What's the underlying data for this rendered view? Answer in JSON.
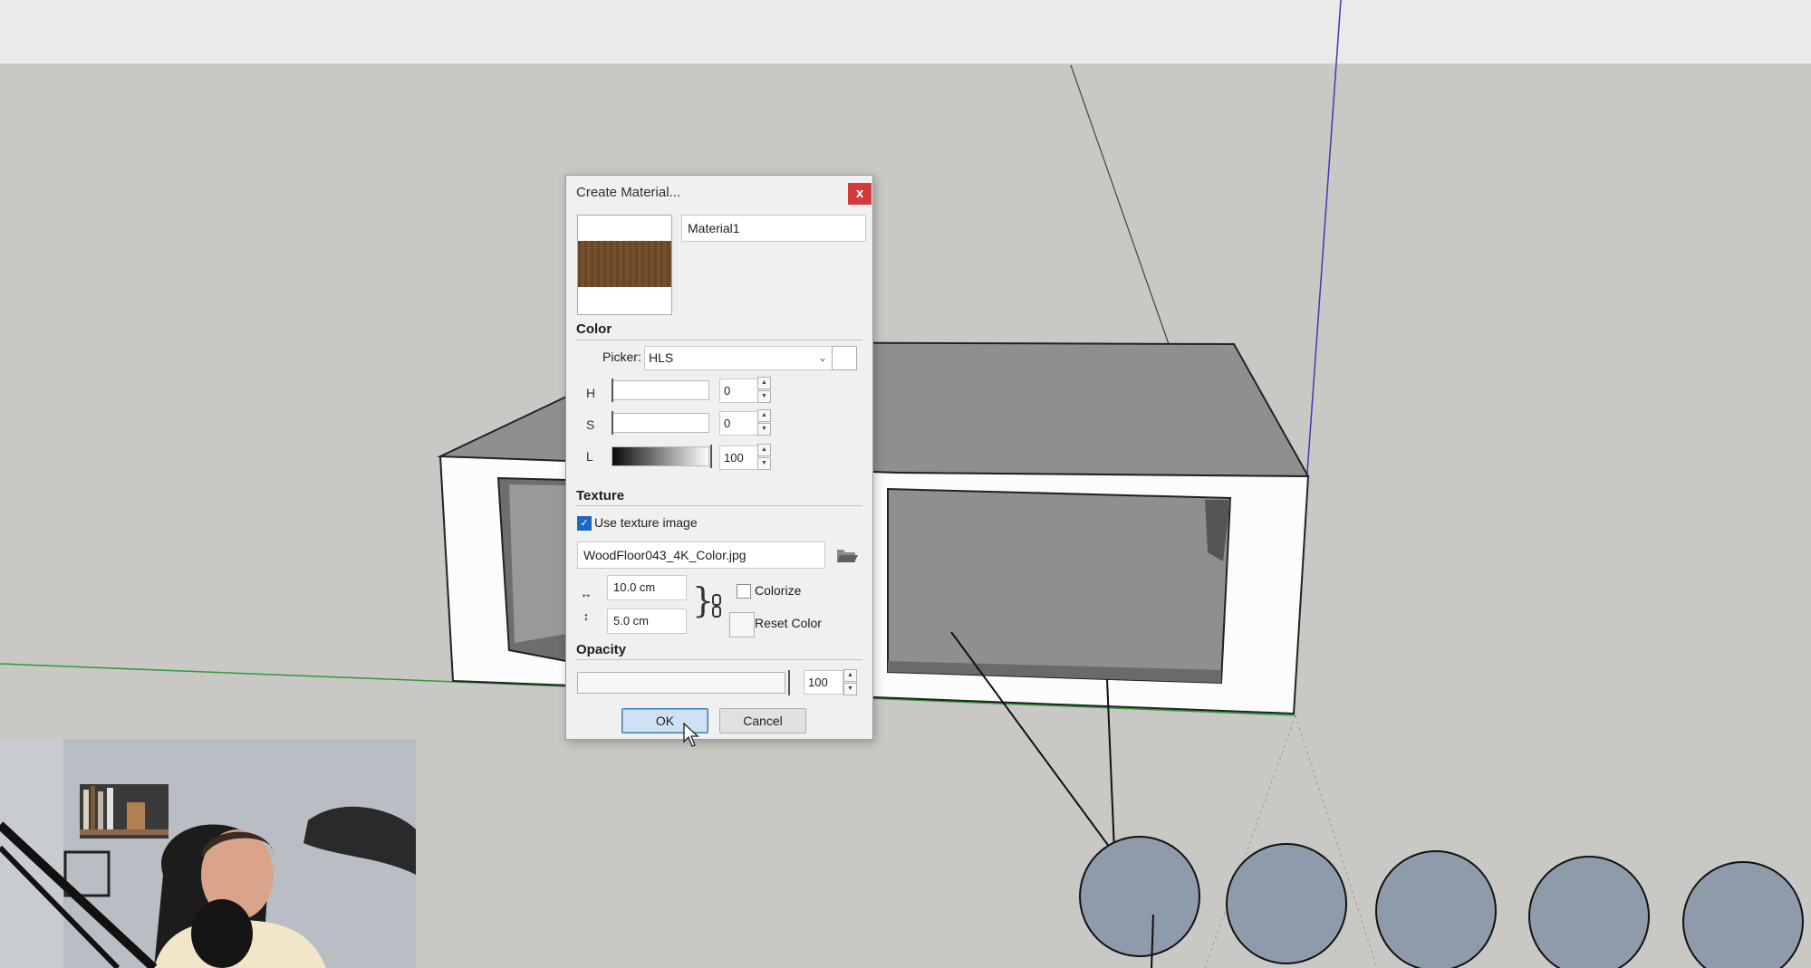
{
  "dialog": {
    "title": "Create Material...",
    "close_label": "x",
    "material_name": "Material1",
    "preview_color": "#6b4a26",
    "color": {
      "section_label": "Color",
      "picker_label": "Picker:",
      "picker_value": "HLS",
      "h_label": "H",
      "s_label": "S",
      "l_label": "L",
      "h_value": "0",
      "s_value": "0",
      "l_value": "100"
    },
    "texture": {
      "section_label": "Texture",
      "use_texture_label": "Use texture image",
      "use_texture_checked": true,
      "file_name": "WoodFloor043_4K_Color.jpg",
      "width_value": "10.0 cm",
      "height_value": "5.0 cm",
      "colorize_label": "Colorize",
      "colorize_checked": false,
      "reset_color_label": "Reset Color"
    },
    "opacity": {
      "section_label": "Opacity",
      "value": "100"
    },
    "buttons": {
      "ok_label": "OK",
      "cancel_label": "Cancel"
    }
  },
  "colors": {
    "close_button": "#d43a3a",
    "checkbox_accent": "#1b68c2",
    "ok_button_bg": "#cfe2f4",
    "viewport_bg": "#c9c8c4"
  }
}
